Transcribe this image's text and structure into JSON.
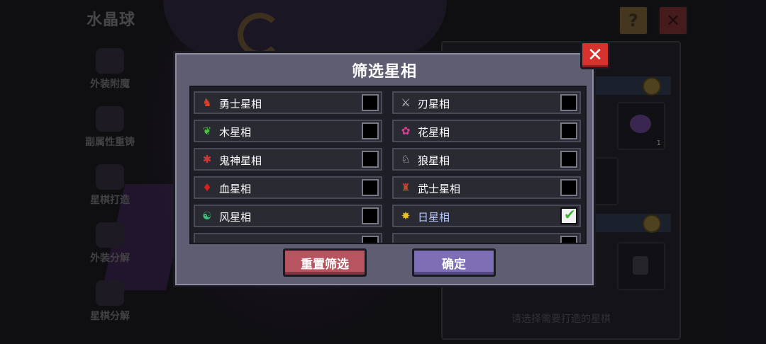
{
  "app": {
    "title": "水晶球"
  },
  "sidebar": {
    "items": [
      {
        "label": "外装附魔"
      },
      {
        "label": "副属性重铸"
      },
      {
        "label": "星棋打造"
      },
      {
        "label": "外装分解"
      },
      {
        "label": "星棋分解"
      }
    ]
  },
  "top_buttons": {
    "help_label": "?",
    "close_label": "✕"
  },
  "right_panel": {
    "slot_count": "1",
    "hint": "请选择需要打造的星棋"
  },
  "dialog": {
    "title": "筛选星相",
    "close_label": "✕",
    "reset_label": "重置筛选",
    "confirm_label": "确定",
    "check_mark": "✔",
    "filters_left": [
      {
        "name": "勇士星相",
        "icon": "warrior-emblem-icon",
        "glyph": "♞",
        "color": "#e0402a",
        "checked": false
      },
      {
        "name": "木星相",
        "icon": "leaf-icon",
        "glyph": "❦",
        "color": "#4cc23c",
        "checked": false
      },
      {
        "name": "鬼神星相",
        "icon": "demon-crab-icon",
        "glyph": "✱",
        "color": "#d83434",
        "checked": false
      },
      {
        "name": "血星相",
        "icon": "blood-drop-icon",
        "glyph": "♦",
        "color": "#d82020",
        "checked": false
      },
      {
        "name": "风星相",
        "icon": "wind-swirl-icon",
        "glyph": "☯",
        "color": "#3bbf7a",
        "checked": false
      }
    ],
    "filters_right": [
      {
        "name": "刃星相",
        "icon": "blade-icon",
        "glyph": "⚔",
        "color": "#c9c9d4",
        "checked": false
      },
      {
        "name": "花星相",
        "icon": "flower-icon",
        "glyph": "✿",
        "color": "#e0409a",
        "checked": false
      },
      {
        "name": "狼星相",
        "icon": "wolf-icon",
        "glyph": "♘",
        "color": "#d4d4dc",
        "checked": false
      },
      {
        "name": "武士星相",
        "icon": "samurai-icon",
        "glyph": "♜",
        "color": "#d04030",
        "checked": false
      },
      {
        "name": "日星相",
        "icon": "sun-icon",
        "glyph": "✸",
        "color": "#e8c020",
        "checked": true
      }
    ]
  }
}
